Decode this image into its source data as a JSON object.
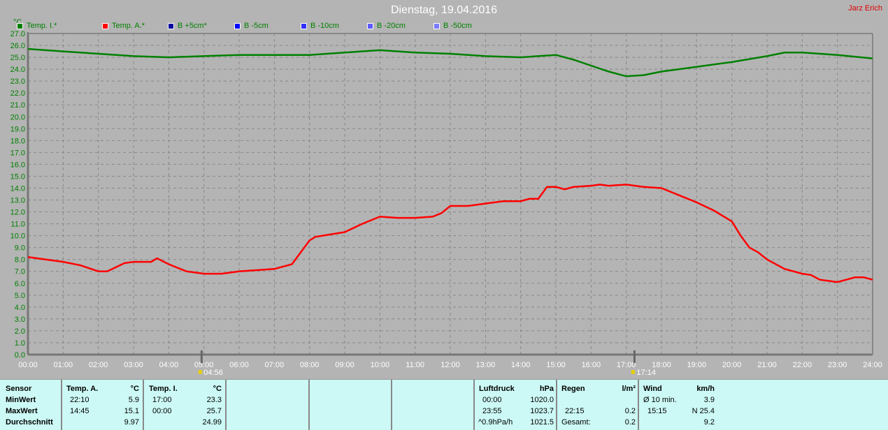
{
  "header": {
    "title": "Dienstag, 19.04.2016",
    "author": "Jarz Erich"
  },
  "colors": {
    "temp_i": "#008000",
    "temp_a": "#ff0000",
    "b_plus5": "#0000a0",
    "b_minus5": "#0000ff",
    "b_minus10": "#3030ff",
    "b_minus20": "#5a5aff",
    "b_minus50": "#7a7aff",
    "background": "#b4b4b4",
    "axis_text": "#ffffff",
    "ylabel_text": "#008000",
    "panel_bg": "#ccf9f5"
  },
  "chart_data": {
    "type": "line",
    "title": "Dienstag, 19.04.2016",
    "ylabel": "°C",
    "ylim": [
      0,
      27
    ],
    "xlim": [
      "00:00",
      "24:00"
    ],
    "grid": true,
    "legend_placement": "top",
    "y_ticks": [
      "0.0",
      "1.0",
      "2.0",
      "3.0",
      "4.0",
      "5.0",
      "6.0",
      "7.0",
      "8.0",
      "9.0",
      "10.0",
      "11.0",
      "12.0",
      "13.0",
      "14.0",
      "15.0",
      "16.0",
      "17.0",
      "18.0",
      "19.0",
      "20.0",
      "21.0",
      "22.0",
      "23.0",
      "24.0",
      "25.0",
      "26.0",
      "27.0"
    ],
    "x_ticks": [
      "00:00",
      "01:00",
      "02:00",
      "03:00",
      "04:00",
      "05:00",
      "06:00",
      "07:00",
      "08:00",
      "09:00",
      "10:00",
      "11:00",
      "12:00",
      "13:00",
      "14:00",
      "15:00",
      "16:00",
      "17:00",
      "18:00",
      "19:00",
      "20:00",
      "21:00",
      "22:00",
      "23:00",
      "24:00"
    ],
    "legend": [
      {
        "name": "Temp. I.*",
        "color": "#008000"
      },
      {
        "name": "Temp. A.*",
        "color": "#ff0000"
      },
      {
        "name": "B +5cm*",
        "color": "#0000a0"
      },
      {
        "name": "B -5cm",
        "color": "#0000ff"
      },
      {
        "name": "B -10cm",
        "color": "#3030ff"
      },
      {
        "name": "B -20cm",
        "color": "#5a5aff"
      },
      {
        "name": "B -50cm",
        "color": "#7a7aff"
      }
    ],
    "markers": [
      {
        "label": "04:56",
        "time": "04:56",
        "type": "sunrise"
      },
      {
        "label": "17:14",
        "time": "17:14",
        "type": "sunset"
      }
    ],
    "series": [
      {
        "name": "Temp. I.*",
        "color": "#008000",
        "points": [
          [
            "00:00",
            25.7
          ],
          [
            "01:00",
            25.5
          ],
          [
            "02:00",
            25.3
          ],
          [
            "03:00",
            25.1
          ],
          [
            "04:00",
            25.0
          ],
          [
            "05:00",
            25.1
          ],
          [
            "06:00",
            25.2
          ],
          [
            "07:00",
            25.2
          ],
          [
            "08:00",
            25.2
          ],
          [
            "09:00",
            25.4
          ],
          [
            "10:00",
            25.6
          ],
          [
            "11:00",
            25.4
          ],
          [
            "12:00",
            25.3
          ],
          [
            "13:00",
            25.1
          ],
          [
            "14:00",
            25.0
          ],
          [
            "14:30",
            25.1
          ],
          [
            "15:00",
            25.2
          ],
          [
            "15:30",
            24.8
          ],
          [
            "16:00",
            24.3
          ],
          [
            "16:30",
            23.8
          ],
          [
            "17:00",
            23.4
          ],
          [
            "17:30",
            23.5
          ],
          [
            "18:00",
            23.8
          ],
          [
            "19:00",
            24.2
          ],
          [
            "20:00",
            24.6
          ],
          [
            "21:00",
            25.1
          ],
          [
            "21:30",
            25.4
          ],
          [
            "22:00",
            25.4
          ],
          [
            "23:00",
            25.2
          ],
          [
            "24:00",
            24.9
          ]
        ]
      },
      {
        "name": "Temp. A.*",
        "color": "#ff0000",
        "points": [
          [
            "00:00",
            8.2
          ],
          [
            "01:00",
            7.8
          ],
          [
            "01:30",
            7.5
          ],
          [
            "02:00",
            7.0
          ],
          [
            "02:15",
            7.0
          ],
          [
            "02:45",
            7.7
          ],
          [
            "03:00",
            7.8
          ],
          [
            "03:30",
            7.8
          ],
          [
            "03:40",
            8.1
          ],
          [
            "04:00",
            7.6
          ],
          [
            "04:30",
            7.0
          ],
          [
            "05:00",
            6.8
          ],
          [
            "05:30",
            6.8
          ],
          [
            "06:00",
            7.0
          ],
          [
            "07:00",
            7.2
          ],
          [
            "07:30",
            7.6
          ],
          [
            "08:00",
            9.6
          ],
          [
            "08:10",
            9.9
          ],
          [
            "09:00",
            10.3
          ],
          [
            "09:30",
            11.0
          ],
          [
            "10:00",
            11.6
          ],
          [
            "10:30",
            11.5
          ],
          [
            "11:00",
            11.5
          ],
          [
            "11:30",
            11.6
          ],
          [
            "11:45",
            11.9
          ],
          [
            "12:00",
            12.5
          ],
          [
            "12:30",
            12.5
          ],
          [
            "13:00",
            12.7
          ],
          [
            "13:30",
            12.9
          ],
          [
            "14:00",
            12.9
          ],
          [
            "14:15",
            13.1
          ],
          [
            "14:30",
            13.1
          ],
          [
            "14:45",
            14.1
          ],
          [
            "15:00",
            14.1
          ],
          [
            "15:15",
            13.9
          ],
          [
            "15:30",
            14.1
          ],
          [
            "16:00",
            14.2
          ],
          [
            "16:15",
            14.3
          ],
          [
            "16:30",
            14.2
          ],
          [
            "17:00",
            14.3
          ],
          [
            "17:15",
            14.2
          ],
          [
            "17:30",
            14.1
          ],
          [
            "18:00",
            14.0
          ],
          [
            "18:30",
            13.4
          ],
          [
            "19:00",
            12.8
          ],
          [
            "19:30",
            12.1
          ],
          [
            "20:00",
            11.2
          ],
          [
            "20:15",
            10.0
          ],
          [
            "20:30",
            9.0
          ],
          [
            "20:45",
            8.6
          ],
          [
            "21:00",
            8.0
          ],
          [
            "21:30",
            7.2
          ],
          [
            "22:00",
            6.8
          ],
          [
            "22:15",
            6.7
          ],
          [
            "22:30",
            6.3
          ],
          [
            "23:00",
            6.1
          ],
          [
            "23:15",
            6.3
          ],
          [
            "23:30",
            6.5
          ],
          [
            "23:45",
            6.5
          ],
          [
            "24:00",
            6.3
          ]
        ]
      }
    ]
  },
  "panel": {
    "sensor": {
      "h": "Sensor",
      "min": "MinWert",
      "max": "MaxWert",
      "avg": "Durchschnitt"
    },
    "temp_a": {
      "h": "Temp. A.",
      "unit": "°C",
      "min_t": "22:10",
      "min_v": "5.9",
      "max_t": "14:45",
      "max_v": "15.1",
      "avg": "9.97"
    },
    "temp_i": {
      "h": "Temp. I.",
      "unit": "°C",
      "min_t": "17:00",
      "min_v": "23.3",
      "max_t": "00:00",
      "max_v": "25.7",
      "avg": "24.99"
    },
    "luftdruck": {
      "h": "Luftdruck",
      "unit": "hPa",
      "r1_t": "00:00",
      "r1_v": "1020.0",
      "r2_t": "23:55",
      "r2_v": "1023.7",
      "r3_t": "^0.9hPa/h",
      "r3_v": "1021.5"
    },
    "regen": {
      "h": "Regen",
      "unit": "l/m²",
      "r2_t": "22:15",
      "r2_v": "0.2",
      "r3_t": "Gesamt:",
      "r3_v": "0.2"
    },
    "wind": {
      "h": "Wind",
      "unit": "km/h",
      "r1_t": "Ø 10 min.",
      "r1_v": "3.9",
      "r2_t": "15:15",
      "r2_v": "N 25.4",
      "r3_v": "9.2"
    }
  }
}
